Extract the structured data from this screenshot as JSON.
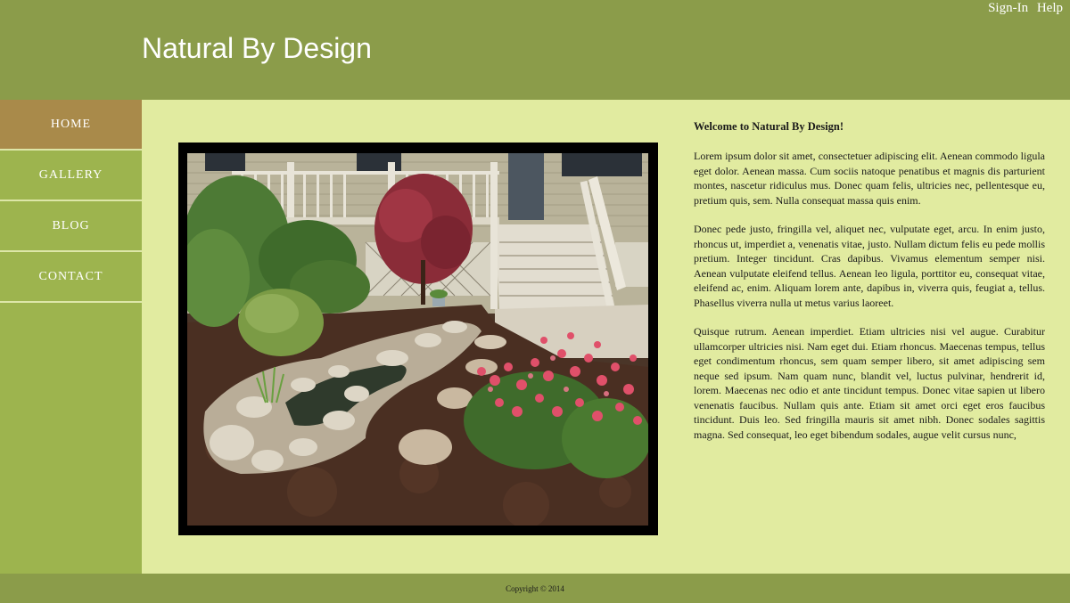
{
  "site": {
    "title": "Natural By Design"
  },
  "top_links": {
    "sign_in": "Sign-In",
    "help": "Help"
  },
  "nav": {
    "items": [
      {
        "label": "HOME"
      },
      {
        "label": "GALLERY"
      },
      {
        "label": "BLOG"
      },
      {
        "label": "CONTACT"
      }
    ]
  },
  "main": {
    "heading": "Welcome to Natural By Design!",
    "paragraphs": [
      "Lorem ipsum dolor sit amet, consectetuer adipiscing elit. Aenean commodo ligula eget dolor. Aenean massa. Cum sociis natoque penatibus et magnis dis parturient montes, nascetur ridiculus mus. Donec quam felis, ultricies nec, pellentesque eu, pretium quis, sem. Nulla consequat massa quis enim.",
      "Donec pede justo, fringilla vel, aliquet nec, vulputate eget, arcu. In enim justo, rhoncus ut, imperdiet a, venenatis vitae, justo. Nullam dictum felis eu pede mollis pretium. Integer tincidunt. Cras dapibus. Vivamus elementum semper nisi. Aenean vulputate eleifend tellus. Aenean leo ligula, porttitor eu, consequat vitae, eleifend ac, enim. Aliquam lorem ante, dapibus in, viverra quis, feugiat a, tellus. Phasellus viverra nulla ut metus varius laoreet.",
      "Quisque rutrum. Aenean imperdiet. Etiam ultricies nisi vel augue. Curabitur ullamcorper ultricies nisi. Nam eget dui. Etiam rhoncus. Maecenas tempus, tellus eget condimentum rhoncus, sem quam semper libero, sit amet adipiscing sem neque sed ipsum. Nam quam nunc, blandit vel, luctus pulvinar, hendrerit id, lorem. Maecenas nec odio et ante tincidunt tempus. Donec vitae sapien ut libero venenatis faucibus. Nullam quis ante. Etiam sit amet orci eget eros faucibus tincidunt. Duis leo. Sed fringilla mauris sit amet nibh. Donec sodales sagittis magna. Sed consequat, leo eget bibendum sodales, augue velit cursus nunc,"
    ]
  },
  "footer": {
    "copyright": "Copyright © 2014"
  },
  "colors": {
    "header": "#8b9c4a",
    "sidebar": "#9db44e",
    "nav_active": "#a98a4a",
    "content_bg": "#e1eba0"
  }
}
